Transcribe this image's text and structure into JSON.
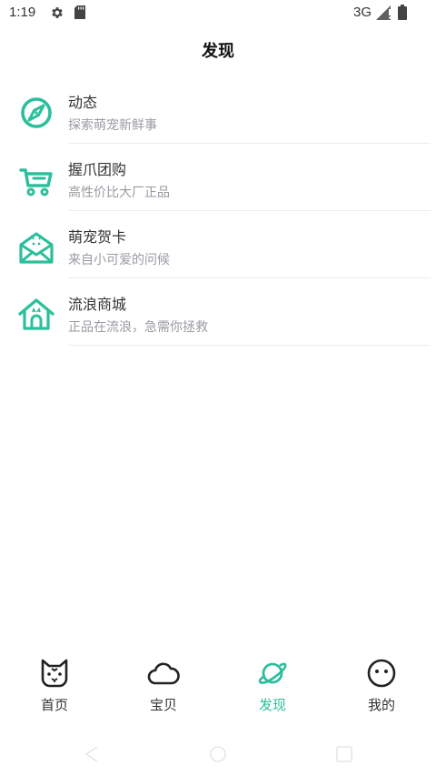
{
  "status_bar": {
    "time": "1:19",
    "network": "3G",
    "icons": [
      "gear-icon",
      "sd-card-icon",
      "signal-icon",
      "battery-icon"
    ]
  },
  "header": {
    "title": "发现"
  },
  "menu": [
    {
      "icon": "compass-icon",
      "title": "动态",
      "subtitle": "探索萌宠新鲜事"
    },
    {
      "icon": "cart-icon",
      "title": "握爪团购",
      "subtitle": "高性价比大厂正品"
    },
    {
      "icon": "envelope-icon",
      "title": "萌宠贺卡",
      "subtitle": "来自小可爱的问候"
    },
    {
      "icon": "house-icon",
      "title": "流浪商城",
      "subtitle": "正品在流浪，急需你拯救"
    }
  ],
  "tabs": [
    {
      "icon": "cat-icon",
      "label": "首页",
      "active": false
    },
    {
      "icon": "cloud-icon",
      "label": "宝贝",
      "active": false
    },
    {
      "icon": "planet-icon",
      "label": "发现",
      "active": true
    },
    {
      "icon": "face-icon",
      "label": "我的",
      "active": false
    }
  ],
  "colors": {
    "accent": "#2bbf9c",
    "text": "#333333",
    "subtext": "#9a9aa2",
    "divider": "#ececec"
  }
}
